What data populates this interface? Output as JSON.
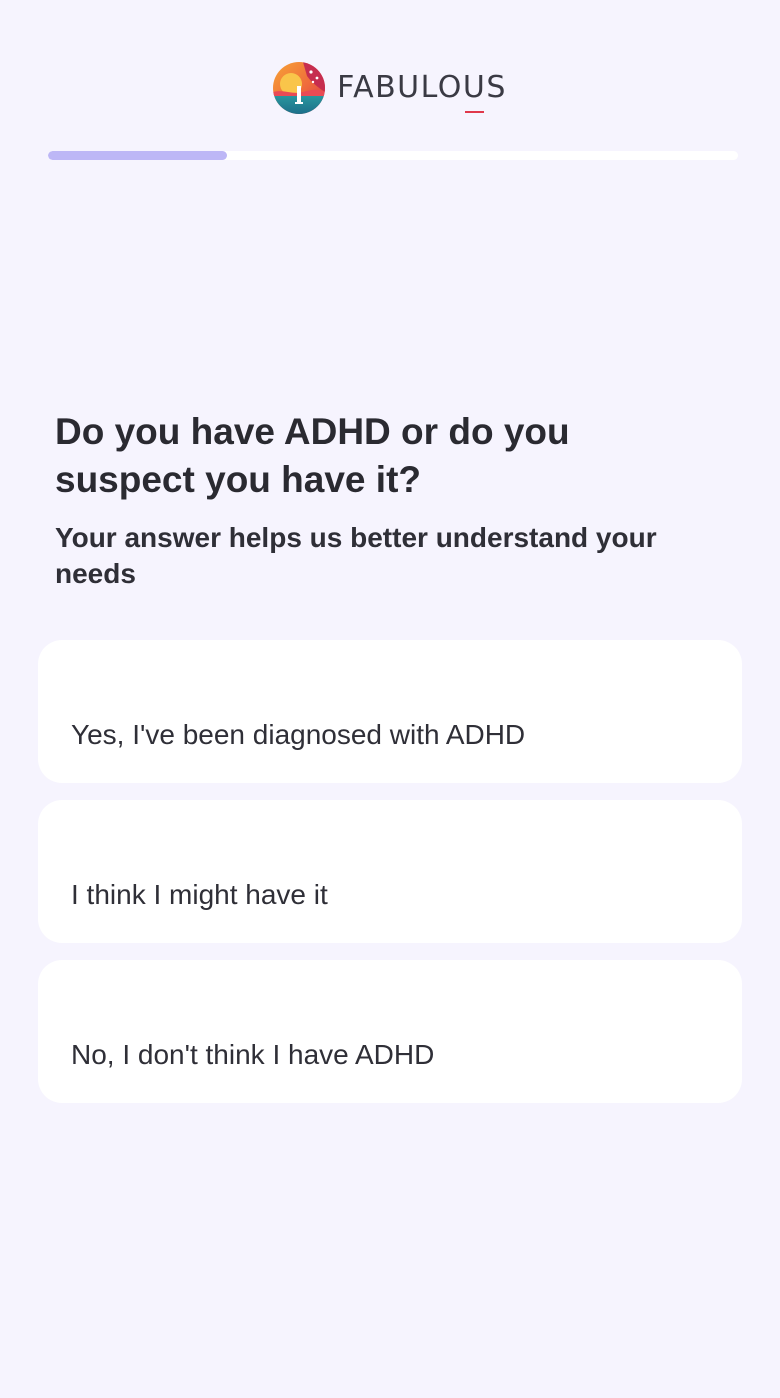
{
  "brand": {
    "name_start": "FABULO",
    "name_accent": "U",
    "name_end": "S",
    "logo_icon": "fabulous-sun-logo-icon",
    "accent_color": "#e0384b"
  },
  "progress": {
    "fraction": 0.26,
    "fill_color": "#bdb7f6"
  },
  "question": {
    "title": "Do you have ADHD or do you suspect you have it?",
    "subtitle": "Your answer helps us better understand your needs"
  },
  "options": [
    {
      "label": "Yes, I've been diagnosed with ADHD"
    },
    {
      "label": "I think I might have it"
    },
    {
      "label": "No, I don't think I have ADHD"
    }
  ]
}
